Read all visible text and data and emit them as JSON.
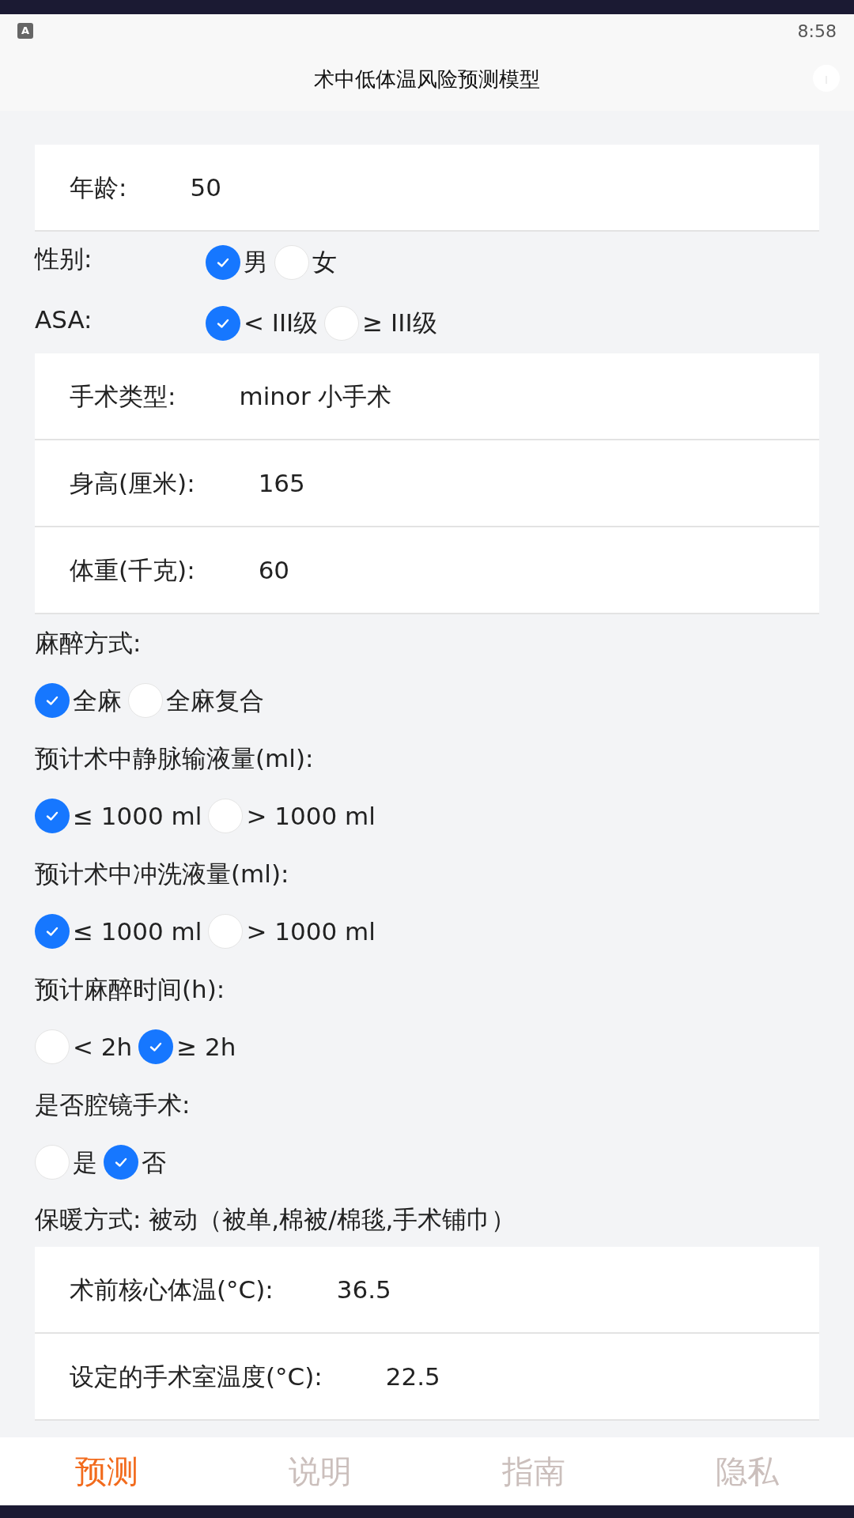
{
  "status_bar": {
    "badge": "A",
    "time": "8:58"
  },
  "header": {
    "title": "术中低体温风险预测模型"
  },
  "form": [
    {
      "kind": "input",
      "label": "年龄:",
      "value": "50"
    },
    {
      "kind": "inline_radio",
      "label": "性别:",
      "options": [
        {
          "label": "男",
          "selected": true
        },
        {
          "label": "女",
          "selected": false
        }
      ]
    },
    {
      "kind": "inline_radio",
      "label": "ASA:",
      "options": [
        {
          "label": "< III级",
          "selected": true
        },
        {
          "label": "≥ III级",
          "selected": false
        }
      ]
    },
    {
      "kind": "input",
      "label": "手术类型:",
      "value": "minor 小手术"
    },
    {
      "kind": "input",
      "label": "身高(厘米):",
      "value": "165"
    },
    {
      "kind": "input",
      "label": "体重(千克):",
      "value": "60"
    },
    {
      "kind": "stacked_radio",
      "label": "麻醉方式:",
      "options": [
        {
          "label": "全麻",
          "selected": true
        },
        {
          "label": "全麻复合",
          "selected": false
        }
      ]
    },
    {
      "kind": "stacked_radio",
      "label": "预计术中静脉输液量(ml):",
      "options": [
        {
          "label": "≤ 1000 ml",
          "selected": true
        },
        {
          "label": "> 1000 ml",
          "selected": false
        }
      ]
    },
    {
      "kind": "stacked_radio",
      "label": "预计术中冲洗液量(ml):",
      "options": [
        {
          "label": "≤ 1000 ml",
          "selected": true
        },
        {
          "label": "> 1000 ml",
          "selected": false
        }
      ]
    },
    {
      "kind": "stacked_radio",
      "label": "预计麻醉时间(h):",
      "options": [
        {
          "label": "< 2h",
          "selected": false
        },
        {
          "label": "≥ 2h",
          "selected": true
        }
      ]
    },
    {
      "kind": "stacked_radio",
      "label": "是否腔镜手术:",
      "options": [
        {
          "label": "是",
          "selected": false
        },
        {
          "label": "否",
          "selected": true
        }
      ]
    },
    {
      "kind": "text",
      "label": "保暖方式: 被动（被单,棉被/棉毯,手术铺巾）"
    },
    {
      "kind": "input",
      "label": "术前核心体温(°C):",
      "value": "36.5"
    },
    {
      "kind": "input",
      "label": "设定的手术室温度(°C):",
      "value": "22.5"
    }
  ],
  "tab_bar": [
    {
      "label": "预测",
      "selected": true
    },
    {
      "label": "说明",
      "selected": false
    },
    {
      "label": "指南",
      "selected": false
    },
    {
      "label": "隐私",
      "selected": false
    }
  ]
}
